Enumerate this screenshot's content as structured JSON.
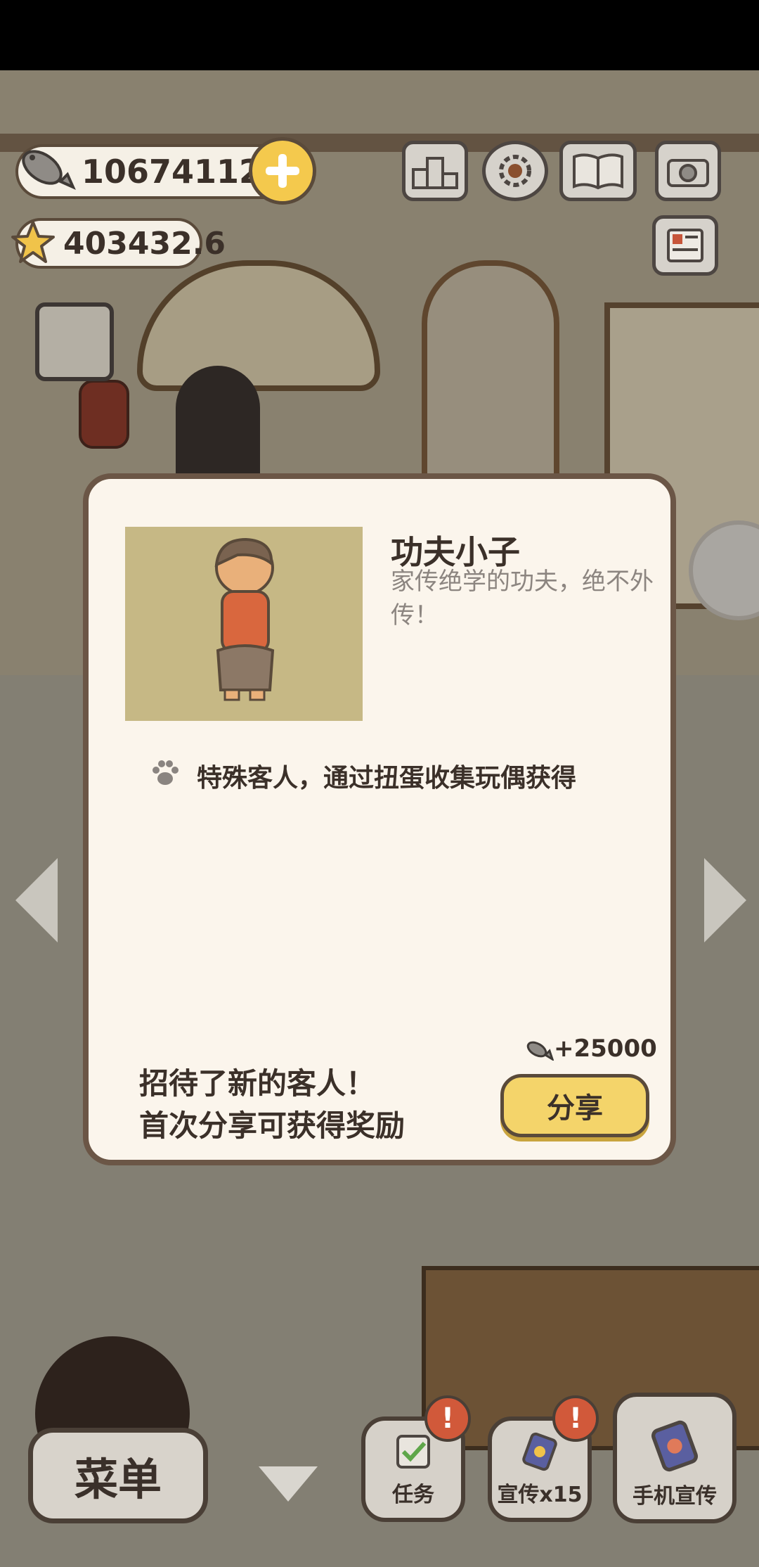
{
  "hud": {
    "fish_count": "106741122",
    "star_count": "403432.6"
  },
  "top_icons": [
    "ranking-icon",
    "settings-gear-icon",
    "cat-book-icon",
    "camera-icon",
    "newspaper-icon"
  ],
  "dialog": {
    "character_name": "功夫小子",
    "character_desc": "家传绝学的功夫，绝不外传！",
    "obtain_method": "特殊客人，通过扭蛋收集玩偶获得",
    "message_line1": "招待了新的客人！",
    "message_line2": "首次分享可获得奖励",
    "reward": "+25000",
    "share_label": "分享"
  },
  "bottom": {
    "menu_label": "菜单",
    "task_label": "任务",
    "promo_label": "宣传x15",
    "phone_promo_label": "手机宣传",
    "alert_mark": "!"
  },
  "colors": {
    "accent_yellow": "#f4d46a",
    "alert_red": "#d1593a",
    "dialog_bg": "#fbf5ec",
    "text_dark": "#3b3029"
  }
}
